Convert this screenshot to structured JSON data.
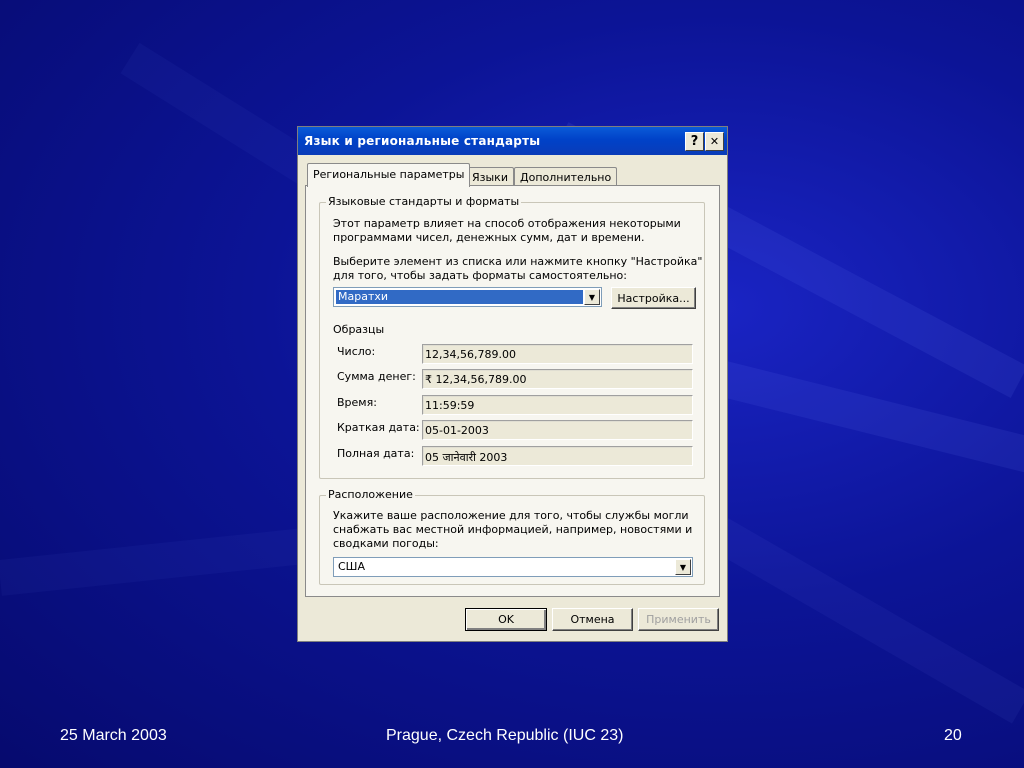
{
  "slide": {
    "footer_date": "25 March 2003",
    "footer_venue": "Prague, Czech Republic (IUC 23)",
    "page_number": "20"
  },
  "dialog": {
    "title": "Язык и региональные стандарты",
    "help_glyph": "?",
    "close_glyph": "✕",
    "tabs": [
      {
        "label": "Региональные параметры",
        "active": true
      },
      {
        "label": "Языки",
        "active": false
      },
      {
        "label": "Дополнительно",
        "active": false
      }
    ],
    "standards_group": {
      "legend": "Языковые стандарты и форматы",
      "description_line1": "Этот параметр влияет на способ отображения некоторыми",
      "description_line2": "программами чисел, денежных сумм, дат и времени.",
      "instruction_line1": "Выберите элемент из списка или нажмите кнопку \"Настройка\"",
      "instruction_line2": "для того, чтобы задать форматы самостоятельно:",
      "locale_value": "Маратхи",
      "customize_label": "Настройка...",
      "samples_heading": "Образцы",
      "samples": [
        {
          "label": "Число:",
          "value": "12,34,56,789.00"
        },
        {
          "label": "Сумма денег:",
          "value": "₹  12,34,56,789.00"
        },
        {
          "label": "Время:",
          "value": "11:59:59"
        },
        {
          "label": "Краткая дата:",
          "value": "05-01-2003"
        },
        {
          "label": "Полная дата:",
          "value": "05 जानेवारी  2003"
        }
      ]
    },
    "location_group": {
      "legend": "Расположение",
      "description_line1": "Укажите ваше расположение для того, чтобы службы могли",
      "description_line2": "снабжать вас местной информацией, например, новостями и",
      "description_line3": "сводками погоды:",
      "location_value": "США"
    },
    "buttons": {
      "ok": "OK",
      "cancel": "Отмена",
      "apply": "Применить"
    }
  },
  "colors": {
    "background": "#0c1496",
    "titlebar": "#0a4ed0",
    "dialog_face": "#ece9d8",
    "selection": "#316ac5"
  }
}
